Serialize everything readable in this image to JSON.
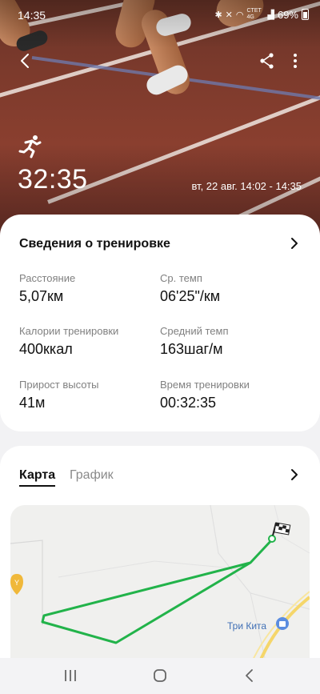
{
  "status_bar": {
    "time": "14:35",
    "network": "CTET 4G",
    "battery": "69%"
  },
  "header": {
    "duration": "32:35",
    "date_range": "вт, 22 авг. 14:02 - 14:35",
    "activity_icon": "running-icon"
  },
  "details": {
    "title": "Сведения о тренировке",
    "stats": [
      {
        "label": "Расстояние",
        "value": "5,07",
        "unit": "км"
      },
      {
        "label": "Ср. темп",
        "value": "06'25\"",
        "unit": "/км"
      },
      {
        "label": "Калории тренировки",
        "value": "400",
        "unit": "ккал"
      },
      {
        "label": "Средний темп",
        "value": "163",
        "unit": "шаг/м"
      },
      {
        "label": "Прирост высоты",
        "value": "41",
        "unit": "м"
      },
      {
        "label": "Время тренировки",
        "value": "00:32:35",
        "unit": ""
      }
    ]
  },
  "map_section": {
    "tabs": [
      {
        "label": "Карта",
        "active": true
      },
      {
        "label": "График",
        "active": false
      }
    ],
    "poi_label": "Три Кита",
    "route_color": "#22b34a"
  },
  "colors": {
    "accent": "#22b34a",
    "poi": "#3f6fb5"
  }
}
